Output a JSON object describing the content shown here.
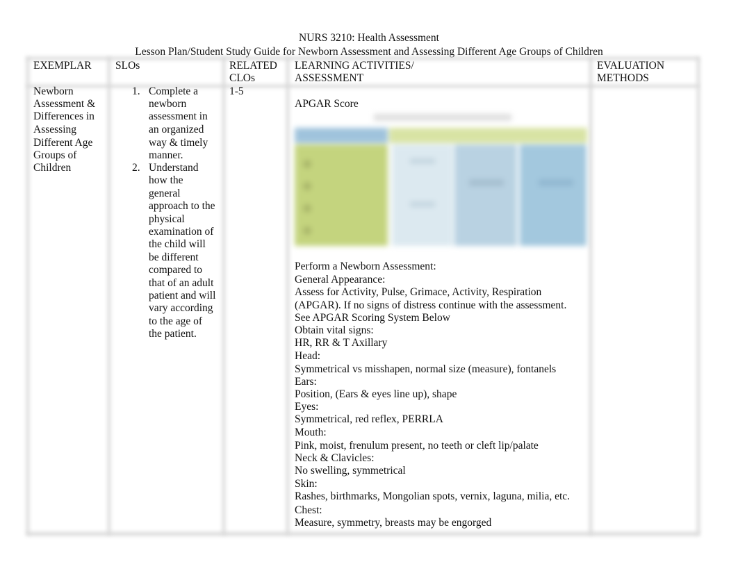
{
  "document": {
    "title": "NURS 3210: Health Assessment",
    "subtitle": "Lesson Plan/Student Study Guide for Newborn Assessment and Assessing Different Age Groups of Children"
  },
  "table": {
    "headers": {
      "exemplar": "EXEMPLAR",
      "slos": "SLOs",
      "related_clos_1": "RELATED",
      "related_clos_2": "CLOs",
      "learning_1": "LEARNING ACTIVITIES/",
      "learning_2": "ASSESSMENT",
      "evaluation_1": "EVALUATION",
      "evaluation_2": "METHODS"
    },
    "row": {
      "exemplar_lines": [
        "Newborn",
        "Assessment &",
        "Differences in",
        "Assessing",
        "Different Age",
        "Groups of",
        "Children"
      ],
      "slos": [
        {
          "number": "1.",
          "lines": [
            "Complete a",
            "newborn",
            "assessment in",
            "an organized",
            "way & timely",
            "manner."
          ]
        },
        {
          "number": "2.",
          "lines": [
            "Understand",
            "how the",
            "general",
            "approach to the",
            "physical",
            "examination of",
            "the child will",
            "be different",
            "compared to",
            "that of an adult",
            "patient and will",
            "vary according",
            "to the age of",
            "the patient."
          ]
        }
      ],
      "related_clos": "1-5",
      "apgar_heading": "APGAR Score",
      "apgar_image_alt": "APGAR Scoring System table (image)",
      "activities": [
        "Perform a Newborn Assessment:",
        "General Appearance:",
        "Assess for Activity, Pulse, Grimace, Activity, Respiration",
        "(APGAR). If no signs of distress continue with the assessment.",
        "See APGAR Scoring System Below",
        "Obtain vital signs:",
        "HR, RR & T Axillary",
        "Head:",
        "Symmetrical vs misshapen, normal size (measure), fontanels",
        "Ears:",
        "Position, (Ears & eyes line up), shape",
        "Eyes:",
        "Symmetrical, red reflex, PERRLA",
        "Mouth:",
        "Pink, moist, frenulum present, no teeth or cleft lip/palate",
        "Neck & Clavicles:",
        "No swelling, symmetrical",
        "Skin:",
        "Rashes, birthmarks, Mongolian spots, vernix, laguna, milia, etc.",
        "Chest:",
        "Measure, symmetry, breasts may be engorged"
      ],
      "evaluation_methods": ""
    }
  },
  "colors": {
    "apgar_header_blue": "#9fc3dc",
    "apgar_header_green": "#d8e3a4",
    "apgar_left_green": "#c4d47e",
    "apgar_col_light": "#dce9f0",
    "apgar_col_mid": "#b9d2e2",
    "apgar_col_blue": "#a3c8de"
  }
}
